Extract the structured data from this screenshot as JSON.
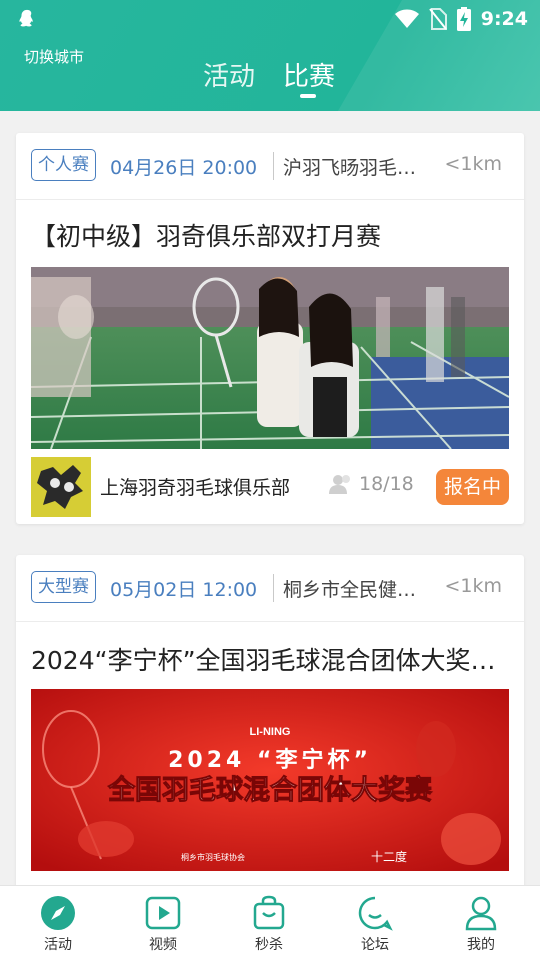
{
  "status_bar": {
    "time": "9:24"
  },
  "header": {
    "city_label": "切换城市",
    "tabs": [
      {
        "label": "活动",
        "active": false
      },
      {
        "label": "比赛",
        "active": true
      }
    ],
    "accent": "#22b59a"
  },
  "events": [
    {
      "badge": "个人赛",
      "datetime": "04月26日 20:00",
      "venue": "沪羽飞旸羽毛…",
      "distance": "<1km",
      "title": "【初中级】羽奇俱乐部双打月赛",
      "club_name": "上海羽奇羽毛球俱乐部",
      "participants": "18/18",
      "status": "报名中"
    },
    {
      "badge": "大型赛",
      "datetime": "05月02日 12:00",
      "venue": "桐乡市全民健…",
      "distance": "<1km",
      "title": "2024“李宁杯”全国羽毛球混合团体大奖…",
      "poster": {
        "brand": "LI-NING",
        "year_line": "2024  “李宁杯”",
        "headline": "全国羽毛球混合团体大奖赛",
        "footer": "桐乡市羽毛球协会",
        "footer_right": "十二度"
      }
    }
  ],
  "bottom_nav": [
    {
      "label": "活动",
      "icon": "compass-icon",
      "active": true
    },
    {
      "label": "视频",
      "icon": "play-icon",
      "active": false
    },
    {
      "label": "秒杀",
      "icon": "bag-icon",
      "active": false
    },
    {
      "label": "论坛",
      "icon": "chat-icon",
      "active": false
    },
    {
      "label": "我的",
      "icon": "person-icon",
      "active": false
    }
  ],
  "colors": {
    "badge_blue": "#4a7fbf",
    "status_orange": "#f4863a",
    "nav_teal": "#23a88f"
  }
}
